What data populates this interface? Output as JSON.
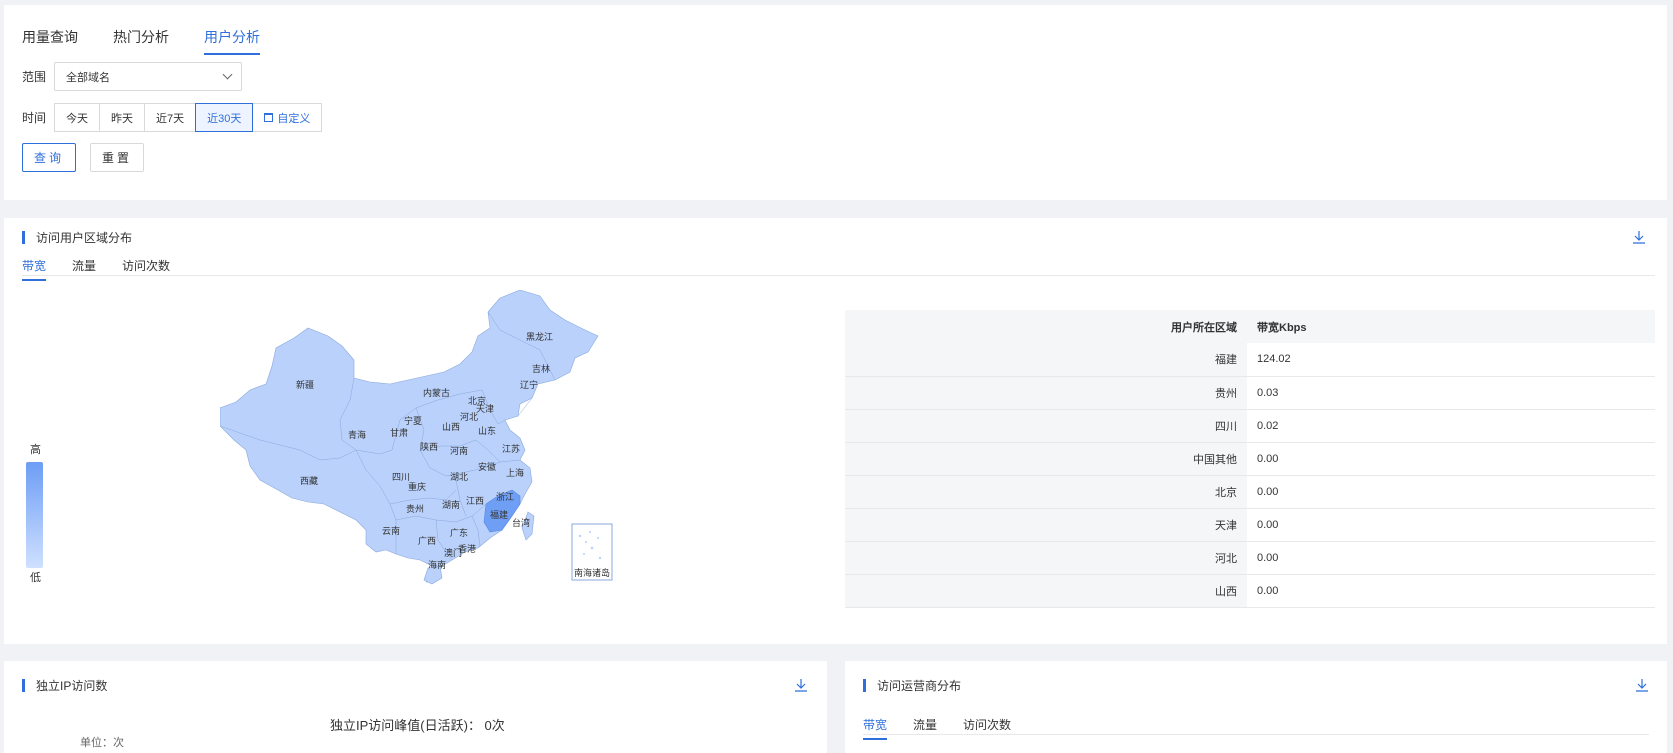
{
  "top_tabs": [
    "用量查询",
    "热门分析",
    "用户分析"
  ],
  "filter": {
    "range_label": "范围",
    "range_value": "全部域名",
    "time_label": "时间",
    "time_options": [
      "今天",
      "昨天",
      "近7天",
      "近30天"
    ],
    "custom_label": "自定义",
    "query_label": "查询",
    "reset_label": "重置"
  },
  "region": {
    "title": "访问用户区域分布",
    "tabs": [
      "带宽",
      "流量",
      "访问次数"
    ],
    "legend_high": "高",
    "legend_low": "低",
    "table_headers": [
      "用户所在区域",
      "带宽Kbps"
    ],
    "rows": [
      [
        "福建",
        "124.02"
      ],
      [
        "贵州",
        "0.03"
      ],
      [
        "四川",
        "0.02"
      ],
      [
        "中国其他",
        "0.00"
      ],
      [
        "北京",
        "0.00"
      ],
      [
        "天津",
        "0.00"
      ],
      [
        "河北",
        "0.00"
      ],
      [
        "山西",
        "0.00"
      ]
    ],
    "map_labels": [
      "黑龙江",
      "吉林",
      "辽宁",
      "内蒙古",
      "北京",
      "天津",
      "河北",
      "新疆",
      "青海",
      "甘肃",
      "宁夏",
      "山西",
      "山东",
      "陕西",
      "河南",
      "江苏",
      "安徽",
      "上海",
      "西藏",
      "四川",
      "湖北",
      "重庆",
      "浙江",
      "贵州",
      "湖南",
      "江西",
      "福建",
      "台湾",
      "云南",
      "广西",
      "广东",
      "澳门",
      "香港",
      "海南",
      "南海诸岛"
    ],
    "colors": {
      "map_fill": "#b9d1fb",
      "map_highlight": "#6f9ff4",
      "accent": "#2f6fdb"
    }
  },
  "ip": {
    "title": "独立IP访问数",
    "peak_text": "独立IP访问峰值(日活跃)：  0次",
    "unit_text": "单位：次"
  },
  "isp": {
    "title": "访问运营商分布",
    "tabs": [
      "带宽",
      "流量",
      "访问次数"
    ]
  }
}
